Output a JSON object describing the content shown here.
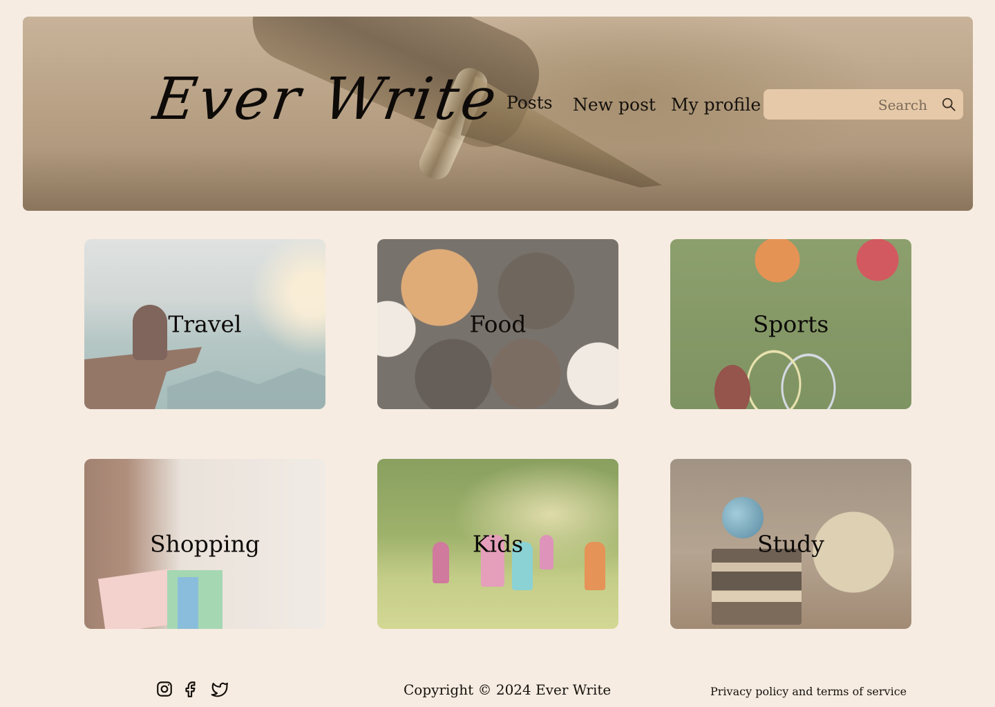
{
  "header": {
    "logo": "Ever Write",
    "nav": {
      "posts": "Posts",
      "new_post": "New post",
      "my_profile": "My profile"
    },
    "search": {
      "placeholder": "Search",
      "icon": "search-icon"
    }
  },
  "categories": [
    {
      "label": "Travel"
    },
    {
      "label": "Food"
    },
    {
      "label": "Sports"
    },
    {
      "label": "Shopping"
    },
    {
      "label": "Kids"
    },
    {
      "label": "Study"
    }
  ],
  "footer": {
    "social": [
      "instagram-icon",
      "facebook-icon",
      "twitter-icon"
    ],
    "copyright": "Copyright © 2024 Ever Write",
    "privacy": "Privacy policy and terms of service"
  },
  "colors": {
    "page_background": "#f6ece2",
    "search_background": "#e6c9a8",
    "text": "#15110d"
  }
}
